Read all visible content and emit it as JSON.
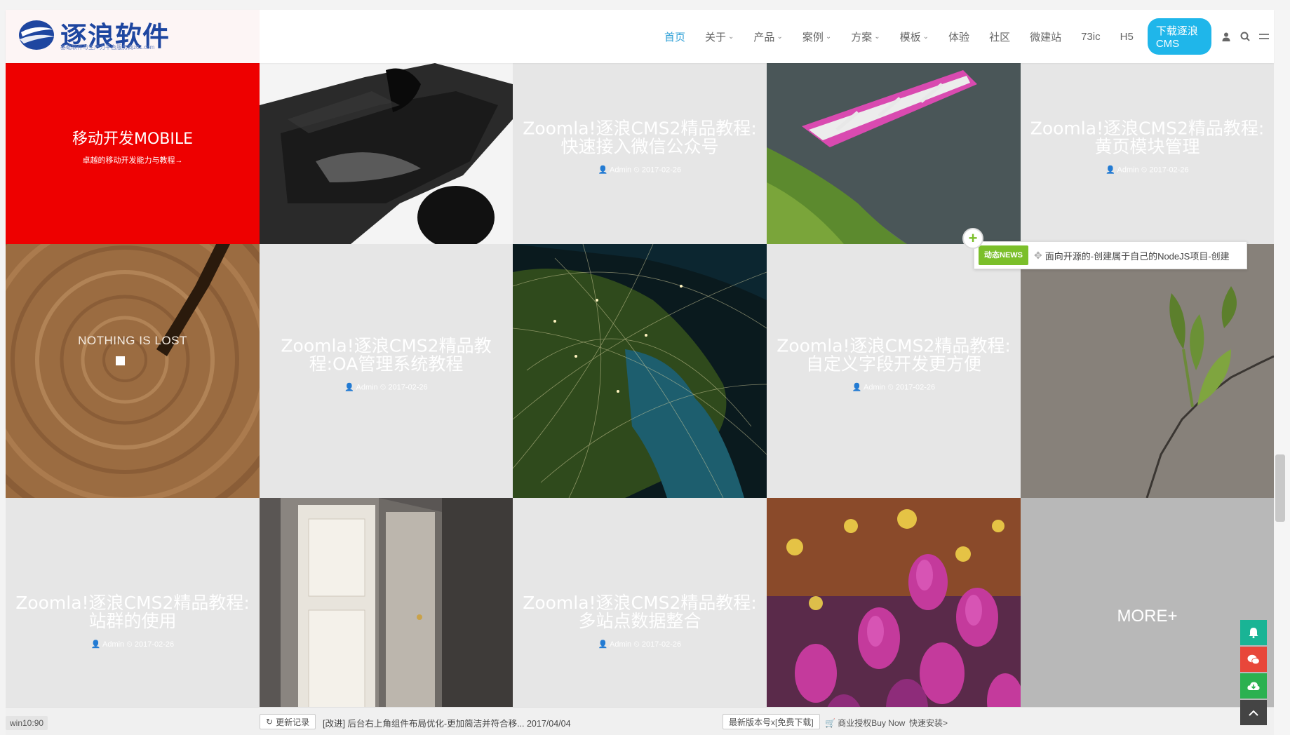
{
  "header": {
    "logo_text": "逐浪软件",
    "logo_sub": "基础软件与生产力平台服务商z01.com",
    "nav": [
      {
        "label": "首页",
        "active": true,
        "dropdown": false
      },
      {
        "label": "关于",
        "dropdown": true
      },
      {
        "label": "产品",
        "dropdown": true
      },
      {
        "label": "案例",
        "dropdown": true
      },
      {
        "label": "方案",
        "dropdown": true
      },
      {
        "label": "模板",
        "dropdown": true
      },
      {
        "label": "体验",
        "dropdown": false
      },
      {
        "label": "社区",
        "dropdown": false
      },
      {
        "label": "微建站",
        "dropdown": false
      },
      {
        "label": "73ic",
        "dropdown": false
      },
      {
        "label": "H5",
        "dropdown": false
      }
    ],
    "download_label": "下载逐浪CMS",
    "icons": [
      "user-icon",
      "search-icon",
      "menu-icon"
    ]
  },
  "tiles": {
    "red": {
      "title": "移动开发MOBILE",
      "sub": "卓越的移动开发能力与教程→"
    },
    "wood": {
      "caption": "NOTHING IS LOST"
    },
    "t1": {
      "title": "Zoomla!逐浪CMS2精品教程:快速接入微信公众号",
      "meta": "👤 Admin ⏲ 2017-02-26"
    },
    "t2": {
      "title": "Zoomla!逐浪CMS2精品教程:黄页模块管理",
      "meta": "👤 Admin ⏲ 2017-02-26"
    },
    "t3": {
      "title": "Zoomla!逐浪CMS2精品教程:OA管理系统教程",
      "meta": "👤 Admin ⏲ 2017-02-26"
    },
    "t4": {
      "title": "Zoomla!逐浪CMS2精品教程:自定义字段开发更方便",
      "meta": "👤 Admin ⏲ 2017-02-26"
    },
    "t5": {
      "title": "Zoomla!逐浪CMS2精品教程:站群的使用",
      "meta": "👤 Admin ⏲ 2017-02-26"
    },
    "t6": {
      "title": "Zoomla!逐浪CMS2精品教程:多站点数据整合",
      "meta": "👤 Admin ⏲ 2017-02-26"
    },
    "more": "MORE+"
  },
  "news": {
    "badge": "动态NEWS",
    "text": "面向开源的-创建属于自己的NodeJS项目-创建"
  },
  "bottom": {
    "left_label": "win10:90",
    "update_btn": "更新记录",
    "update_text": "[改进] 后台右上角组件布局优化-更加简洁并符合移... 2017/04/04",
    "version_btn": "最新版本号x[免费下载]",
    "buy_link": "商业授权Buy Now",
    "install_link": "快速安装>"
  },
  "colors": {
    "accent": "#2c9fd6",
    "download": "#1fb6ea",
    "red_tile": "#ee0000",
    "news_green": "#7bbf2a",
    "teal": "#19b495",
    "wechat_red": "#e8473a",
    "cloud_green": "#2bb150",
    "dark_btn": "#444444"
  }
}
